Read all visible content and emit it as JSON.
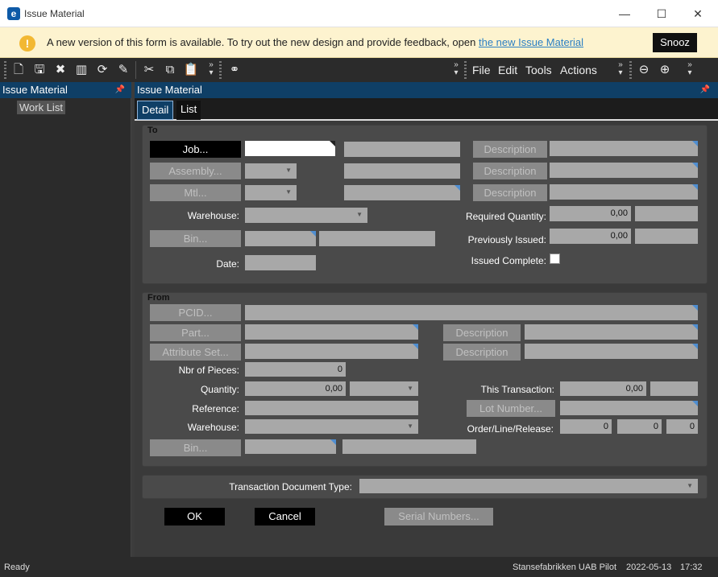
{
  "window": {
    "title": "Issue Material",
    "app_icon": "e",
    "controls": {
      "minimize": "—",
      "maximize": "☐",
      "close": "✕"
    }
  },
  "notification": {
    "text": "A new version of this form is available. To try out the new design and provide feedback, open",
    "link": "the new Issue Material",
    "snooze": "Snooz"
  },
  "menus": [
    "File",
    "Edit",
    "Tools",
    "Actions"
  ],
  "left_panel": {
    "header": "Issue Material",
    "item": "Work List"
  },
  "main_panel": {
    "header": "Issue Material"
  },
  "tabs": [
    "Detail",
    "List"
  ],
  "to": {
    "title": "To",
    "job_button": "Job...",
    "assembly_button": "Assembly...",
    "mtl_button": "Mtl...",
    "description_button": "Description",
    "warehouse_label": "Warehouse:",
    "bin_button": "Bin...",
    "date_label": "Date:",
    "required_qty_label": "Required Quantity:",
    "required_qty_value": "0,00",
    "previously_issued_label": "Previously Issued:",
    "previously_issued_value": "0,00",
    "issued_complete_label": "Issued Complete:"
  },
  "from": {
    "title": "From",
    "pcid_button": "PCID...",
    "part_button": "Part...",
    "attribute_set_button": "Attribute Set...",
    "description_button": "Description",
    "nbr_pieces_label": "Nbr of Pieces:",
    "nbr_pieces_value": "0",
    "quantity_label": "Quantity:",
    "quantity_value": "0,00",
    "reference_label": "Reference:",
    "warehouse_label": "Warehouse:",
    "bin_button": "Bin...",
    "this_transaction_label": "This Transaction:",
    "this_transaction_value": "0,00",
    "lot_number_button": "Lot Number...",
    "order_line_release_label": "Order/Line/Release:",
    "order_value": "0",
    "line_value": "0",
    "release_value": "0"
  },
  "transaction_doc_type_label": "Transaction Document Type:",
  "buttons": {
    "ok": "OK",
    "cancel": "Cancel",
    "serial_numbers": "Serial Numbers..."
  },
  "status": {
    "left": "Ready",
    "company": "Stansefabrikken UAB Pilot",
    "date": "2022-05-13",
    "time": "17:32"
  },
  "colors": {
    "accent": "#0f3f66",
    "notification_bg": "#fdf3cf",
    "warning": "#f2b833",
    "link": "#2a7fc4"
  }
}
